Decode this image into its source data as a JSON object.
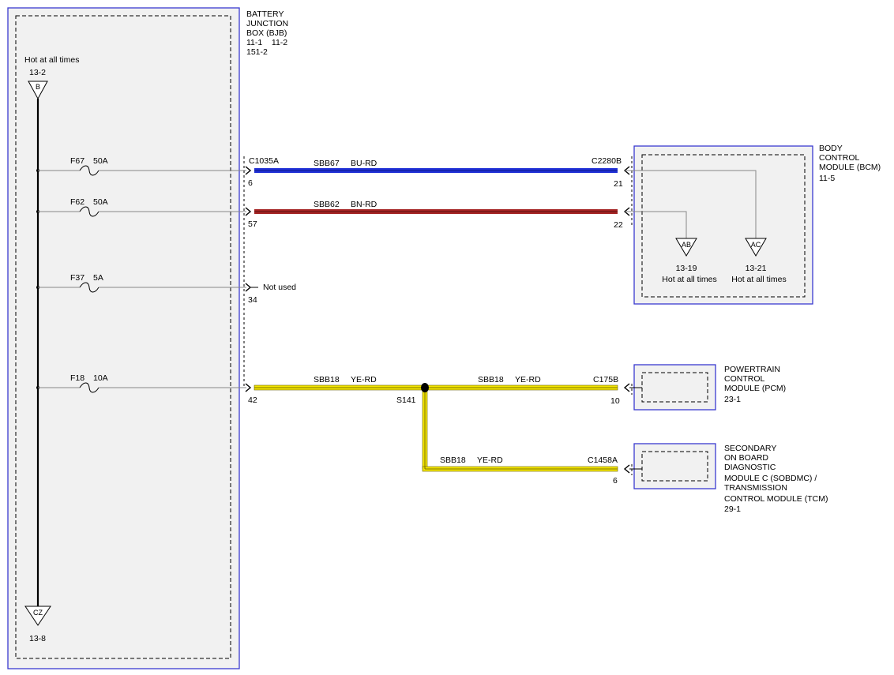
{
  "bjb": {
    "label_lines": [
      "BATTERY",
      "JUNCTION",
      "BOX (BJB)",
      "11-1    11-2",
      "151-2"
    ],
    "hot_label": "Hot at all times",
    "top_ref": "13-2",
    "top_letter": "B",
    "bottom_letter": "CZ",
    "bottom_ref": "13-8"
  },
  "fuses": [
    {
      "id": "F67",
      "rating": "50A"
    },
    {
      "id": "F62",
      "rating": "50A"
    },
    {
      "id": "F37",
      "rating": "5A"
    },
    {
      "id": "F18",
      "rating": "10A"
    }
  ],
  "connectors": {
    "bjb_c": "C1035A",
    "bjb_pins": [
      "6",
      "57",
      "34",
      "42"
    ],
    "not_used": "Not used",
    "bcm_c": "C2280B",
    "bcm_pins": [
      "21",
      "22"
    ],
    "pcm_c": "C175B",
    "pcm_pin": "10",
    "tcm_c": "C1458A",
    "tcm_pin": "6",
    "splice": "S141"
  },
  "wires": [
    {
      "circuit": "SBB67",
      "color_code": "BU-RD",
      "color": "#1f2fd6"
    },
    {
      "circuit": "SBB62",
      "color_code": "BN-RD",
      "color": "#a52424"
    },
    {
      "circuit": "SBB18",
      "color_code": "YE-RD",
      "color": "#f2e400"
    },
    {
      "circuit": "SBB18",
      "color_code": "YE-RD",
      "color": "#f2e400"
    },
    {
      "circuit": "SBB18",
      "color_code": "YE-RD",
      "color": "#f2e400"
    }
  ],
  "bcm": {
    "label_lines": [
      "BODY",
      "CONTROL",
      "MODULE (BCM)",
      "11-5"
    ],
    "ab_letter": "AB",
    "ab_ref": "13-19",
    "ab_text": "Hot at all times",
    "ac_letter": "AC",
    "ac_ref": "13-21",
    "ac_text": "Hot at all times"
  },
  "pcm": {
    "label_lines": [
      "POWERTRAIN",
      "CONTROL",
      "MODULE (PCM)",
      "23-1"
    ]
  },
  "tcm": {
    "label_lines": [
      "SECONDARY",
      "ON BOARD",
      "DIAGNOSTIC",
      "MODULE C (SOBDMC) /",
      "TRANSMISSION",
      "CONTROL MODULE (TCM)",
      "29-1"
    ]
  },
  "colors": {
    "box_border": "#3a3ad0",
    "box_fill": "#f1f1f1",
    "red_wire": "#a52424",
    "blue_wire": "#1f2fd6",
    "yellow_wire": "#f2e400"
  }
}
